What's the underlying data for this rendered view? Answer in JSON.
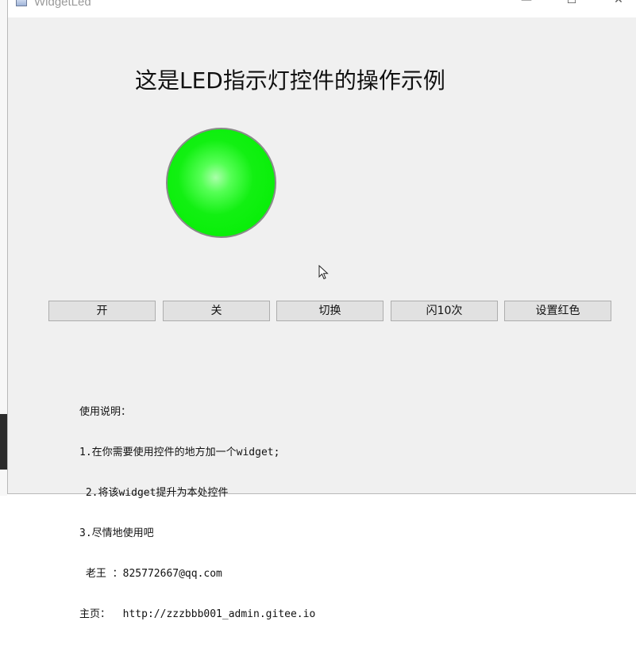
{
  "window": {
    "title": "WidgetLed",
    "minimize": "—",
    "maximize": "☐",
    "close": "✕"
  },
  "main": {
    "headline": "这是LED指示灯控件的操作示例",
    "led": {
      "state": "on",
      "color": "#00ee00"
    }
  },
  "buttons": {
    "on": "开",
    "off": "关",
    "toggle": "切换",
    "blink": "闪10次",
    "set_red": "设置红色"
  },
  "instructions": {
    "lines": [
      "使用说明：",
      "1.在你需要使用控件的地方加一个widget;",
      " 2.将该widget提升为本处控件",
      "3.尽情地使用吧",
      " 老王 ：825772667@qq.com",
      "主页：  http://zzzbbb001_admin.gitee.io"
    ]
  }
}
